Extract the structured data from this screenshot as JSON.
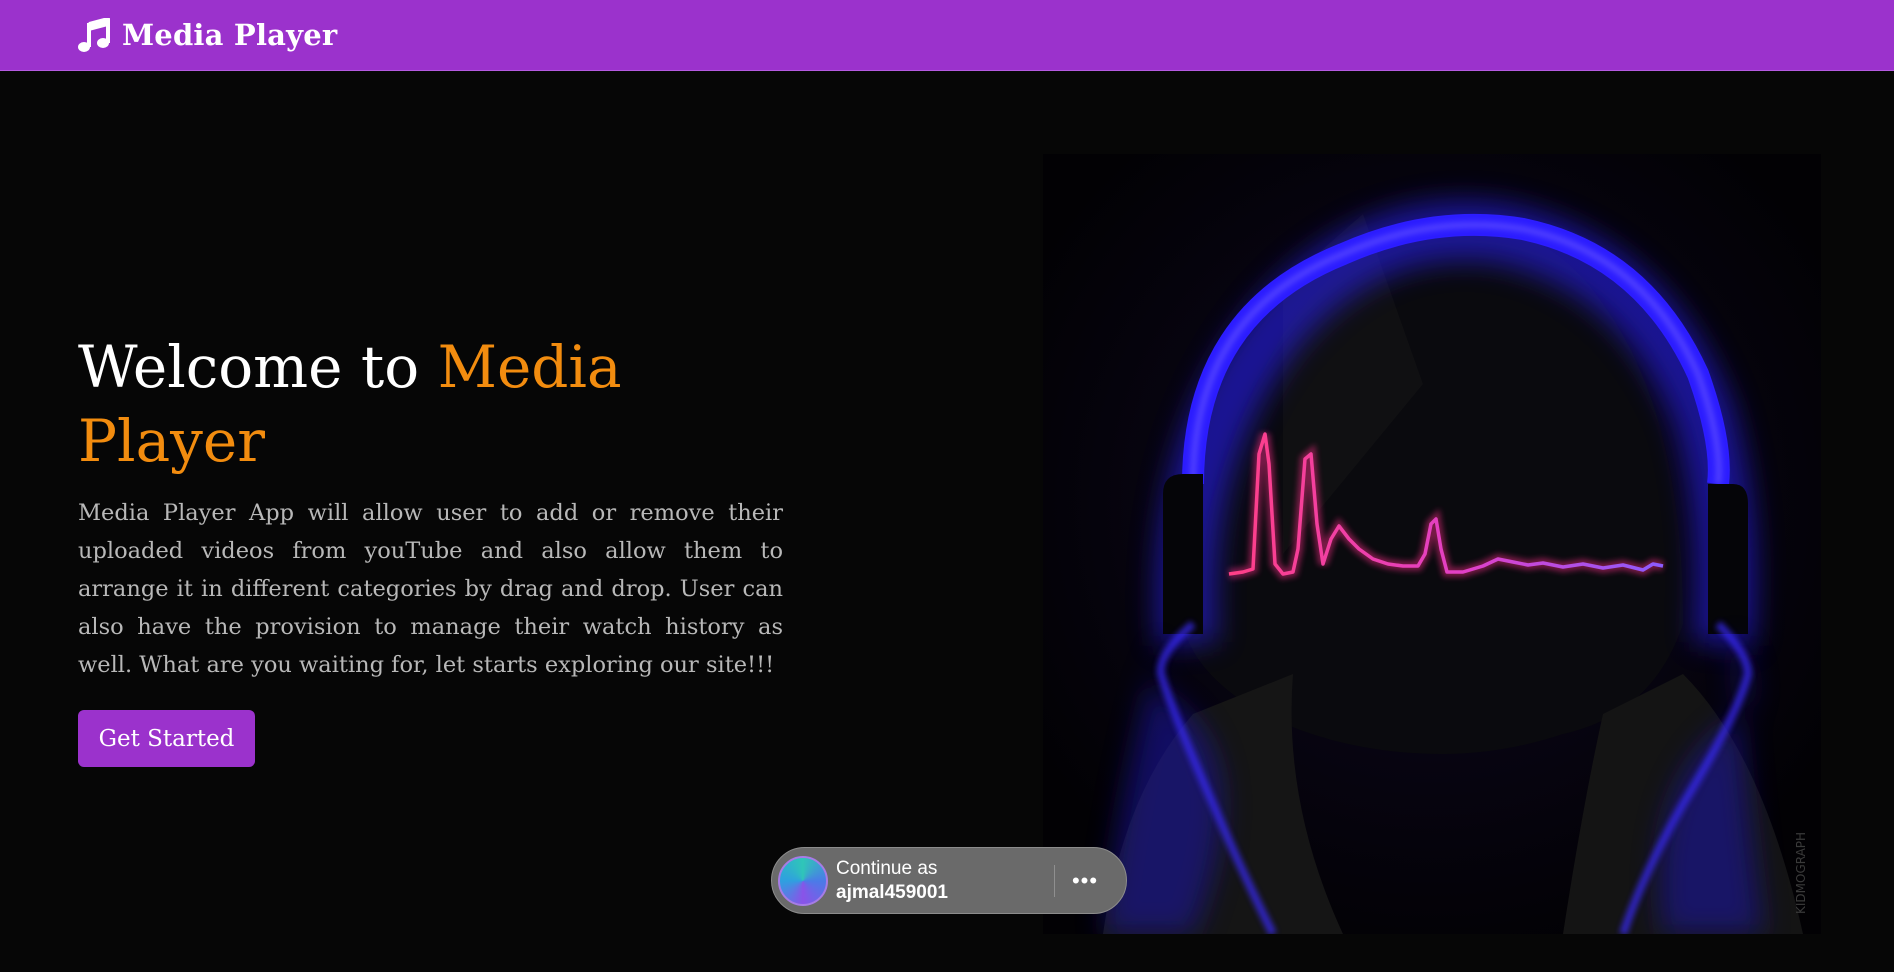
{
  "navbar": {
    "brand_icon": "music-note-icon",
    "brand_text": "Media Player",
    "background": "#9b32cc"
  },
  "hero": {
    "title_prefix": "Welcome to ",
    "title_accent": "Media Player",
    "accent_color": "#f28c0f",
    "description": "Media Player App will allow user to add or remove their uploaded videos from youTube and also allow them to arrange it in different categories by drag and drop. User can also have the provision to manage their watch history as well. What are you waiting for, let starts exploring our site!!!",
    "cta_label": "Get Started",
    "image_alt": "headphones with pulse waveform"
  },
  "signin_prompt": {
    "label": "Continue as",
    "username": "ajmal459001",
    "more_icon": "more-horizontal-icon"
  }
}
